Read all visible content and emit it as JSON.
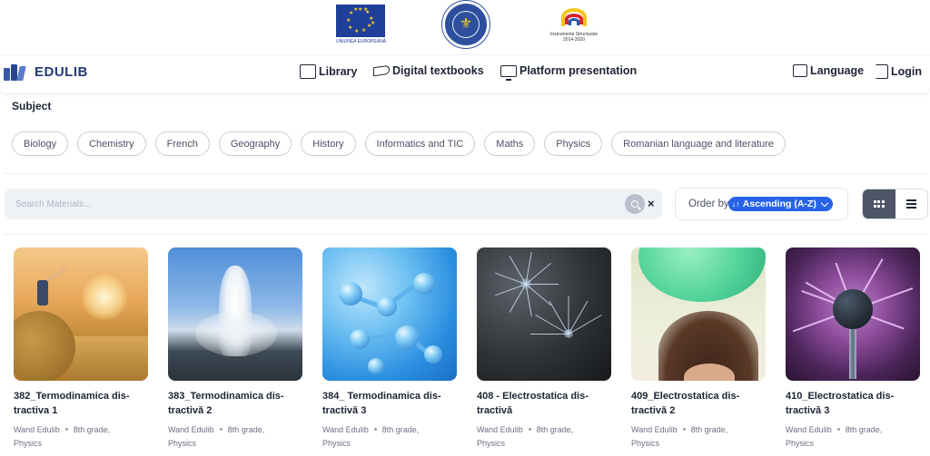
{
  "logos": {
    "eu_caption": "UNIUNEA EUROPEANĂ",
    "is_caption_line1": "Instrumente Structurale",
    "is_caption_line2": "2014-2020"
  },
  "navbar": {
    "brand": "EDULIB",
    "items": [
      {
        "label": "Library",
        "icon": "library-icon"
      },
      {
        "label": "Digital textbooks",
        "icon": "book-icon"
      },
      {
        "label": "Platform presentation",
        "icon": "monitor-icon"
      }
    ],
    "language_label": "Language",
    "login_label": "Login"
  },
  "subject": {
    "title": "Subject",
    "chips": [
      "Biology",
      "Chemistry",
      "French",
      "Geography",
      "History",
      "Informatics and TIC",
      "Maths",
      "Physics",
      "Romanian language and literature"
    ]
  },
  "search": {
    "placeholder": "Search Materials...",
    "value": "",
    "clear_label": "×"
  },
  "order": {
    "label": "Order by",
    "selected": "Ascending (A-Z)"
  },
  "view": {
    "active": "grid",
    "accent": "#4f5566"
  },
  "colors": {
    "accent": "#2663e8",
    "brand": "#233a76"
  },
  "cards": [
    {
      "title": "382_Termodinamica dis-tractiva 1",
      "author": "Wand Edulib",
      "grade": "8th grade,",
      "subject": "Physics",
      "thumb": "boy-on-hay-bale-sunset"
    },
    {
      "title": "383_Termodinamica dis-tractivă 2",
      "author": "Wand Edulib",
      "grade": "8th grade,",
      "subject": "Physics",
      "thumb": "geyser-eruption"
    },
    {
      "title": "384_ Termodinamica dis-tractivă 3",
      "author": "Wand Edulib",
      "grade": "8th grade,",
      "subject": "Physics",
      "thumb": "blue-molecules"
    },
    {
      "title": "408 - Electrostatica dis-tractivă",
      "author": "Wand Edulib",
      "grade": "8th grade,",
      "subject": "Physics",
      "thumb": "dandelion-seed-dark"
    },
    {
      "title": "409_Electrostatica dis-tractivă 2",
      "author": "Wand Edulib",
      "grade": "8th grade,",
      "subject": "Physics",
      "thumb": "balloon-static-hair"
    },
    {
      "title": "410_Electrostatica dis-tractivă 3",
      "author": "Wand Edulib",
      "grade": "8th grade,",
      "subject": "Physics",
      "thumb": "plasma-ball"
    }
  ]
}
